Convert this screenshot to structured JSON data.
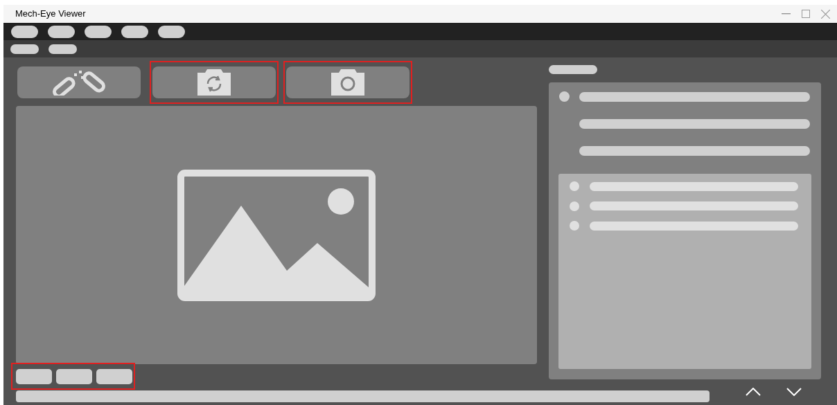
{
  "window": {
    "title": "Mech-Eye Viewer"
  },
  "menu_bar": [
    {
      "kind": "pill"
    },
    {
      "kind": "pill"
    },
    {
      "kind": "pill"
    },
    {
      "kind": "pill"
    },
    {
      "kind": "pill"
    }
  ],
  "sub_bar": [
    {
      "kind": "pill"
    },
    {
      "kind": "pill"
    }
  ],
  "toolbar": [
    {
      "kind": "disconnect",
      "highlighted": false
    },
    {
      "kind": "capture_continuous",
      "highlighted": true
    },
    {
      "kind": "capture_single",
      "highlighted": true
    }
  ],
  "bottom_buttons": {
    "highlighted": true,
    "items": [
      {
        "kind": "pill"
      },
      {
        "kind": "pill"
      },
      {
        "kind": "pill"
      }
    ]
  },
  "info_panel": {
    "rows": [
      {
        "bullet": true
      },
      {
        "bullet": false
      },
      {
        "bullet": false
      }
    ],
    "sub_rows": [
      {
        "bullet": true
      },
      {
        "bullet": true
      },
      {
        "bullet": true
      }
    ]
  }
}
